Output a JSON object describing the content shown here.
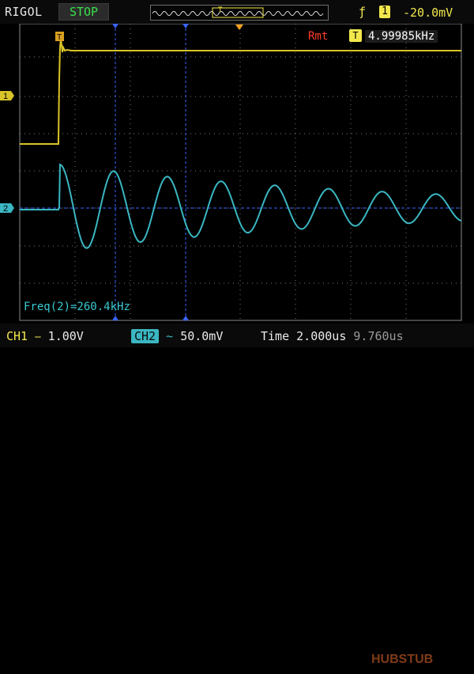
{
  "brand": "RIGOL",
  "run_state": "STOP",
  "trigger": {
    "edge_icon": "rising-edge-icon",
    "channel": "1",
    "level": "-20.0mV",
    "marker_label": "T"
  },
  "measure": {
    "label": "Rmt",
    "badge": "T",
    "value": "4.99985kHz"
  },
  "cursor_readout": "Freq(2)=260.4kHz",
  "bottom": {
    "ch1_label": "CH1",
    "ch1_value": "1.00V",
    "ch2_label": "CH2",
    "ch2_value": "50.0mV",
    "time_label": "Time",
    "time_value": "2.000us",
    "time_offset": "9.760us"
  },
  "channel_markers": [
    "1",
    "2"
  ],
  "watermark": "HUBSTUB",
  "colors": {
    "ch1": "#d8c428",
    "ch2": "#3ab7c2",
    "grid": "#7a7a7a",
    "cursor": "#3a66ff",
    "stop": "#39e04a",
    "rmt": "#ff3b2e",
    "trigger": "#f2e84c"
  }
}
